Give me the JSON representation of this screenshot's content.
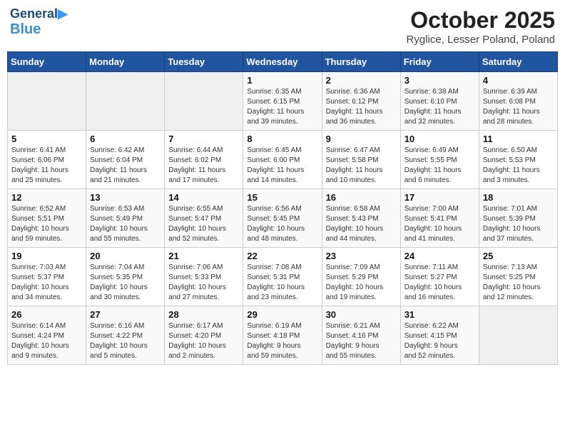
{
  "header": {
    "logo_line1": "General",
    "logo_line2": "Blue",
    "month": "October 2025",
    "location": "Ryglice, Lesser Poland, Poland"
  },
  "weekdays": [
    "Sunday",
    "Monday",
    "Tuesday",
    "Wednesday",
    "Thursday",
    "Friday",
    "Saturday"
  ],
  "weeks": [
    [
      {
        "day": "",
        "info": ""
      },
      {
        "day": "",
        "info": ""
      },
      {
        "day": "",
        "info": ""
      },
      {
        "day": "1",
        "info": "Sunrise: 6:35 AM\nSunset: 6:15 PM\nDaylight: 11 hours\nand 39 minutes."
      },
      {
        "day": "2",
        "info": "Sunrise: 6:36 AM\nSunset: 6:12 PM\nDaylight: 11 hours\nand 36 minutes."
      },
      {
        "day": "3",
        "info": "Sunrise: 6:38 AM\nSunset: 6:10 PM\nDaylight: 11 hours\nand 32 minutes."
      },
      {
        "day": "4",
        "info": "Sunrise: 6:39 AM\nSunset: 6:08 PM\nDaylight: 11 hours\nand 28 minutes."
      }
    ],
    [
      {
        "day": "5",
        "info": "Sunrise: 6:41 AM\nSunset: 6:06 PM\nDaylight: 11 hours\nand 25 minutes."
      },
      {
        "day": "6",
        "info": "Sunrise: 6:42 AM\nSunset: 6:04 PM\nDaylight: 11 hours\nand 21 minutes."
      },
      {
        "day": "7",
        "info": "Sunrise: 6:44 AM\nSunset: 6:02 PM\nDaylight: 11 hours\nand 17 minutes."
      },
      {
        "day": "8",
        "info": "Sunrise: 6:45 AM\nSunset: 6:00 PM\nDaylight: 11 hours\nand 14 minutes."
      },
      {
        "day": "9",
        "info": "Sunrise: 6:47 AM\nSunset: 5:58 PM\nDaylight: 11 hours\nand 10 minutes."
      },
      {
        "day": "10",
        "info": "Sunrise: 6:49 AM\nSunset: 5:55 PM\nDaylight: 11 hours\nand 6 minutes."
      },
      {
        "day": "11",
        "info": "Sunrise: 6:50 AM\nSunset: 5:53 PM\nDaylight: 11 hours\nand 3 minutes."
      }
    ],
    [
      {
        "day": "12",
        "info": "Sunrise: 6:52 AM\nSunset: 5:51 PM\nDaylight: 10 hours\nand 59 minutes."
      },
      {
        "day": "13",
        "info": "Sunrise: 6:53 AM\nSunset: 5:49 PM\nDaylight: 10 hours\nand 55 minutes."
      },
      {
        "day": "14",
        "info": "Sunrise: 6:55 AM\nSunset: 5:47 PM\nDaylight: 10 hours\nand 52 minutes."
      },
      {
        "day": "15",
        "info": "Sunrise: 6:56 AM\nSunset: 5:45 PM\nDaylight: 10 hours\nand 48 minutes."
      },
      {
        "day": "16",
        "info": "Sunrise: 6:58 AM\nSunset: 5:43 PM\nDaylight: 10 hours\nand 44 minutes."
      },
      {
        "day": "17",
        "info": "Sunrise: 7:00 AM\nSunset: 5:41 PM\nDaylight: 10 hours\nand 41 minutes."
      },
      {
        "day": "18",
        "info": "Sunrise: 7:01 AM\nSunset: 5:39 PM\nDaylight: 10 hours\nand 37 minutes."
      }
    ],
    [
      {
        "day": "19",
        "info": "Sunrise: 7:03 AM\nSunset: 5:37 PM\nDaylight: 10 hours\nand 34 minutes."
      },
      {
        "day": "20",
        "info": "Sunrise: 7:04 AM\nSunset: 5:35 PM\nDaylight: 10 hours\nand 30 minutes."
      },
      {
        "day": "21",
        "info": "Sunrise: 7:06 AM\nSunset: 5:33 PM\nDaylight: 10 hours\nand 27 minutes."
      },
      {
        "day": "22",
        "info": "Sunrise: 7:08 AM\nSunset: 5:31 PM\nDaylight: 10 hours\nand 23 minutes."
      },
      {
        "day": "23",
        "info": "Sunrise: 7:09 AM\nSunset: 5:29 PM\nDaylight: 10 hours\nand 19 minutes."
      },
      {
        "day": "24",
        "info": "Sunrise: 7:11 AM\nSunset: 5:27 PM\nDaylight: 10 hours\nand 16 minutes."
      },
      {
        "day": "25",
        "info": "Sunrise: 7:13 AM\nSunset: 5:25 PM\nDaylight: 10 hours\nand 12 minutes."
      }
    ],
    [
      {
        "day": "26",
        "info": "Sunrise: 6:14 AM\nSunset: 4:24 PM\nDaylight: 10 hours\nand 9 minutes."
      },
      {
        "day": "27",
        "info": "Sunrise: 6:16 AM\nSunset: 4:22 PM\nDaylight: 10 hours\nand 5 minutes."
      },
      {
        "day": "28",
        "info": "Sunrise: 6:17 AM\nSunset: 4:20 PM\nDaylight: 10 hours\nand 2 minutes."
      },
      {
        "day": "29",
        "info": "Sunrise: 6:19 AM\nSunset: 4:18 PM\nDaylight: 9 hours\nand 59 minutes."
      },
      {
        "day": "30",
        "info": "Sunrise: 6:21 AM\nSunset: 4:16 PM\nDaylight: 9 hours\nand 55 minutes."
      },
      {
        "day": "31",
        "info": "Sunrise: 6:22 AM\nSunset: 4:15 PM\nDaylight: 9 hours\nand 52 minutes."
      },
      {
        "day": "",
        "info": ""
      }
    ]
  ]
}
